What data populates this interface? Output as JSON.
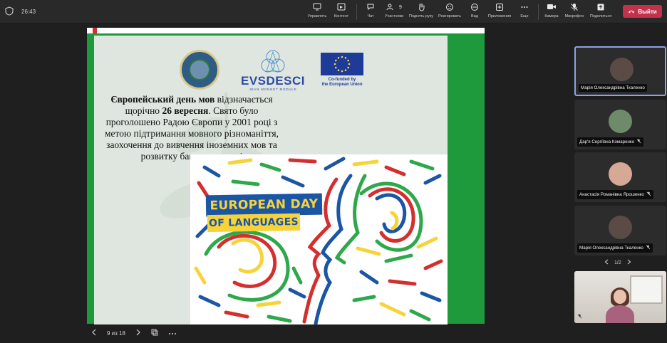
{
  "topbar": {
    "time": "26:43",
    "tools_left": [
      {
        "icon": "share-screen-icon",
        "label": "Управлять"
      },
      {
        "icon": "content-icon",
        "label": "Контент"
      }
    ],
    "tools_mid": [
      {
        "icon": "chat-icon",
        "label": "Чат"
      },
      {
        "icon": "participants-icon",
        "label": "Участники",
        "badge": "9"
      },
      {
        "icon": "raise-hand-icon",
        "label": "Поднять руку"
      },
      {
        "icon": "react-icon",
        "label": "Реагировать"
      },
      {
        "icon": "view-icon",
        "label": "Вид"
      },
      {
        "icon": "apps-icon",
        "label": "Приложения"
      },
      {
        "icon": "more-icon",
        "label": "Еще"
      }
    ],
    "tools_right": [
      {
        "icon": "camera-icon",
        "label": "Камера"
      },
      {
        "icon": "mic-off-icon",
        "label": "Микрофон"
      },
      {
        "icon": "share-icon",
        "label": "Поделиться"
      }
    ],
    "leave_label": "Выйти",
    "leave_color": "#c4314b"
  },
  "slide": {
    "evs_word": "EVSDESCI",
    "evs_sub": "JEAN MONNET MODULE",
    "eu_caption_1": "Co-funded by",
    "eu_caption_2": "the European Union",
    "text_bold_1": "Європейський день мов",
    "text_1": " відзначається щорічно ",
    "text_bold_2": "26 вересня",
    "text_2": ". Свято було проголошено Радою Європи у 2001 році з метою підтримання мовного різноманіття, заохочення до вивчення іноземних мов та розвитку багатомовності",
    "art_line_1": "EUROPEAN DAY",
    "art_line_2": "OF LANGUAGES",
    "frame_color": "#1e9a3c"
  },
  "pager": {
    "count": "9 из 18"
  },
  "participants": [
    {
      "name": "Марія Олександрівна Ткаленко",
      "muted": false,
      "active": true
    },
    {
      "name": "Дар'я Сергіївна Комаренко",
      "muted": true,
      "active": false
    },
    {
      "name": "Анастасія Романівна Ярошенко",
      "muted": true,
      "active": false
    },
    {
      "name": "Марія Олександрівна Ткаленко",
      "muted": true,
      "active": false
    }
  ],
  "tile_pager": {
    "count": "1/2"
  }
}
